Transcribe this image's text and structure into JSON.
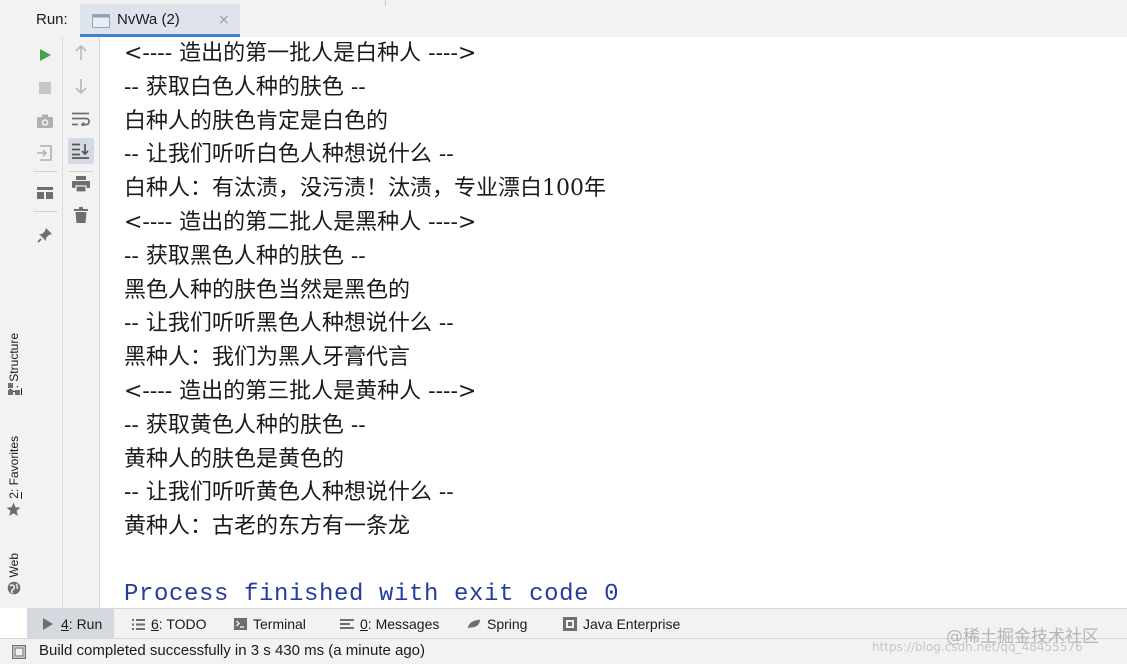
{
  "run_header": {
    "label": "Run:",
    "tab_title": "NvWa (2)",
    "tab_icon": "console-config-icon",
    "close_glyph": "×"
  },
  "left_strip": {
    "structure_prefix": "7",
    "structure_label": ": Structure",
    "favorites_prefix": "2",
    "favorites_label": ": Favorites",
    "web_label": "Web"
  },
  "toolbar_a": [
    "rerun-icon",
    "stop-icon",
    "camera-icon",
    "restore-layout-icon",
    "layout-icon",
    "pin-icon"
  ],
  "toolbar_b": [
    "up-arrow-icon",
    "down-arrow-icon",
    "soft-wrap-icon",
    "scroll-to-end-icon",
    "print-icon",
    "trash-icon"
  ],
  "console": {
    "lines": [
      "<---- 造出的第一批人是白种人 ---->",
      "-- 获取白色人种的肤色 --",
      "白种人的肤色肯定是白色的",
      "-- 让我们听听白色人种想说什么 --",
      "白种人：有汰渍，没污渍！汰渍，专业漂白100年",
      "<---- 造出的第二批人是黑种人 ---->",
      "-- 获取黑色人种的肤色 --",
      "黑色人种的肤色当然是黑色的",
      "-- 让我们听听黑色人种想说什么 --",
      "黑种人：我们为黑人牙膏代言",
      "<---- 造出的第三批人是黄种人 ---->",
      "-- 获取黄色人种的肤色 --",
      "黄种人的肤色是黄色的",
      "-- 让我们听听黄色人种想说什么 --",
      "黄种人：古老的东方有一条龙",
      "",
      "Process finished with exit code 0"
    ],
    "exit_color": "#243d9f"
  },
  "bottom_bar": {
    "run_prefix": "4",
    "run_label": ": Run",
    "todo_prefix": "6",
    "todo_label": ": TODO",
    "terminal_label": "Terminal",
    "messages_prefix": "0",
    "messages_label": ": Messages",
    "spring_label": "Spring",
    "java_label": "Java Enterprise"
  },
  "status": {
    "text": "Build completed successfully in 3 s 430 ms (a minute ago)"
  },
  "watermark": {
    "line1": "@稀土掘金技术社区",
    "line2": "https://blog.csdn.net/qq_48455576"
  },
  "colors": {
    "rerun_green": "#3fa34d",
    "accent_blue": "#4083c9"
  }
}
